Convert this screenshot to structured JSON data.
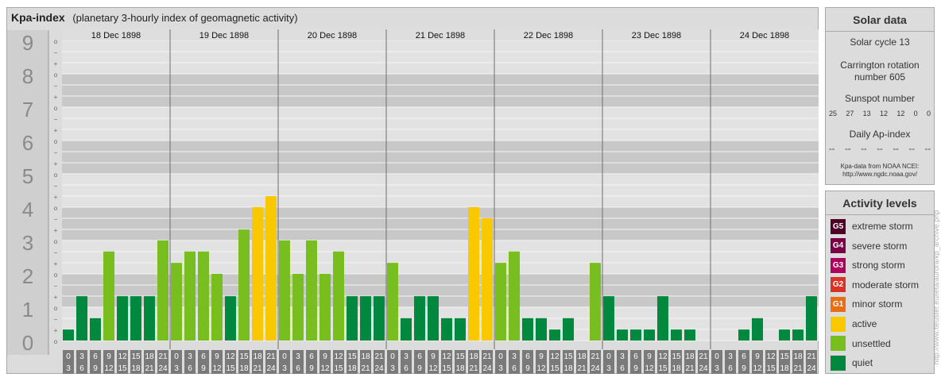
{
  "header": {
    "title": "Kpa-index",
    "subtitle": "(planetary 3-hourly index of geomagnetic activity)"
  },
  "chart_data": {
    "type": "bar",
    "title": "Kpa-index",
    "subtitle": "(planetary 3-hourly index of geomagnetic activity)",
    "ylim": [
      0,
      9
    ],
    "y_ticks": [
      "0",
      "1",
      "2",
      "3",
      "4",
      "5",
      "6",
      "7",
      "8",
      "9"
    ],
    "y_subticks": [
      "o",
      "+",
      "−"
    ],
    "days": [
      "18 Dec 1898",
      "19 Dec 1898",
      "20 Dec 1898",
      "21 Dec 1898",
      "22 Dec 1898",
      "23 Dec 1898",
      "24 Dec 1898"
    ],
    "interval_starts": [
      "0",
      "3",
      "6",
      "9",
      "12",
      "15",
      "18",
      "21"
    ],
    "interval_ends": [
      "3",
      "6",
      "9",
      "12",
      "15",
      "18",
      "21",
      "24"
    ],
    "values": [
      [
        0.33,
        1.33,
        0.67,
        2.67,
        1.33,
        1.33,
        1.33,
        3.0
      ],
      [
        2.33,
        2.67,
        2.67,
        2.0,
        1.33,
        3.33,
        4.0,
        4.33
      ],
      [
        3.0,
        2.0,
        3.0,
        2.0,
        2.67,
        1.33,
        1.33,
        1.33
      ],
      [
        2.33,
        0.67,
        1.33,
        1.33,
        0.67,
        0.67,
        4.0,
        3.67
      ],
      [
        2.33,
        2.67,
        0.67,
        0.67,
        0.33,
        0.67,
        0.0,
        2.33
      ],
      [
        1.33,
        0.33,
        0.33,
        0.33,
        1.33,
        0.33,
        0.33,
        0.0
      ],
      [
        0.0,
        0.0,
        0.33,
        0.67,
        0.0,
        0.33,
        0.33,
        1.33
      ]
    ],
    "grid": true,
    "legend_position": "right"
  },
  "solar": {
    "heading": "Solar data",
    "cycle": "Solar cycle 13",
    "carrington_line1": "Carrington rotation",
    "carrington_line2": "number 605",
    "sunspot_label": "Sunspot number",
    "sunspot_values": [
      "25",
      "27",
      "13",
      "12",
      "12",
      "0",
      "0"
    ],
    "ap_label": "Daily Ap-index",
    "ap_values": [
      "--",
      "--",
      "--",
      "--",
      "--",
      "--",
      "--"
    ],
    "source_line1": "Kpa-data from NOAA NCEI:",
    "source_line2": "http://www.ngdc.noaa.gov/"
  },
  "activity": {
    "heading": "Activity levels",
    "levels": [
      {
        "badge": "G5",
        "label": "extreme storm",
        "color": "#4e0026"
      },
      {
        "badge": "G4",
        "label": "severe storm",
        "color": "#7c0045"
      },
      {
        "badge": "G3",
        "label": "strong storm",
        "color": "#ad005e"
      },
      {
        "badge": "G2",
        "label": "moderate storm",
        "color": "#d83324"
      },
      {
        "badge": "G1",
        "label": "minor storm",
        "color": "#e86e10"
      },
      {
        "badge": "",
        "label": "active",
        "color": "#fac800"
      },
      {
        "badge": "",
        "label": "unsettled",
        "color": "#77be1e"
      },
      {
        "badge": "",
        "label": "quiet",
        "color": "#00893e"
      }
    ]
  },
  "credit": "http://www.fieuster.eu/leta/aurora/kp_archive.php"
}
